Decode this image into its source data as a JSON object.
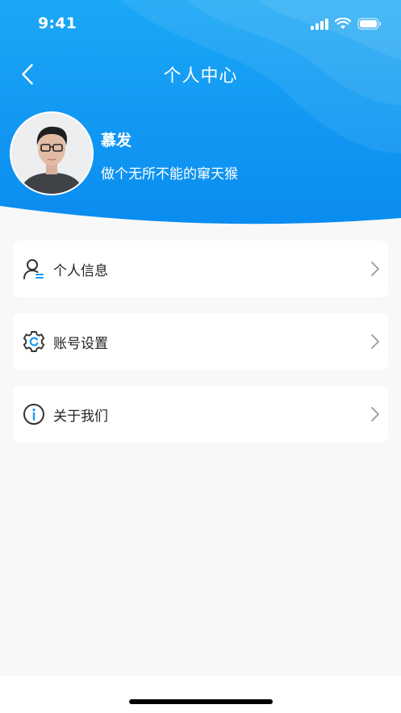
{
  "status_bar": {
    "time": "9:41"
  },
  "nav": {
    "title": "个人中心",
    "back_icon": "chevron-left-icon"
  },
  "profile": {
    "name": "慕发",
    "bio": "做个无所不能的窜天猴"
  },
  "menu": {
    "items": [
      {
        "label": "个人信息",
        "icon": "user-info-icon"
      },
      {
        "label": "账号设置",
        "icon": "settings-gear-icon"
      },
      {
        "label": "关于我们",
        "icon": "info-circle-icon"
      }
    ]
  },
  "colors": {
    "header_gradient_start": "#1ea7f5",
    "header_gradient_end": "#0a8ef0",
    "page_background": "#f8f8f8",
    "card_background": "#ffffff",
    "accent_blue": "#1a9af5"
  }
}
